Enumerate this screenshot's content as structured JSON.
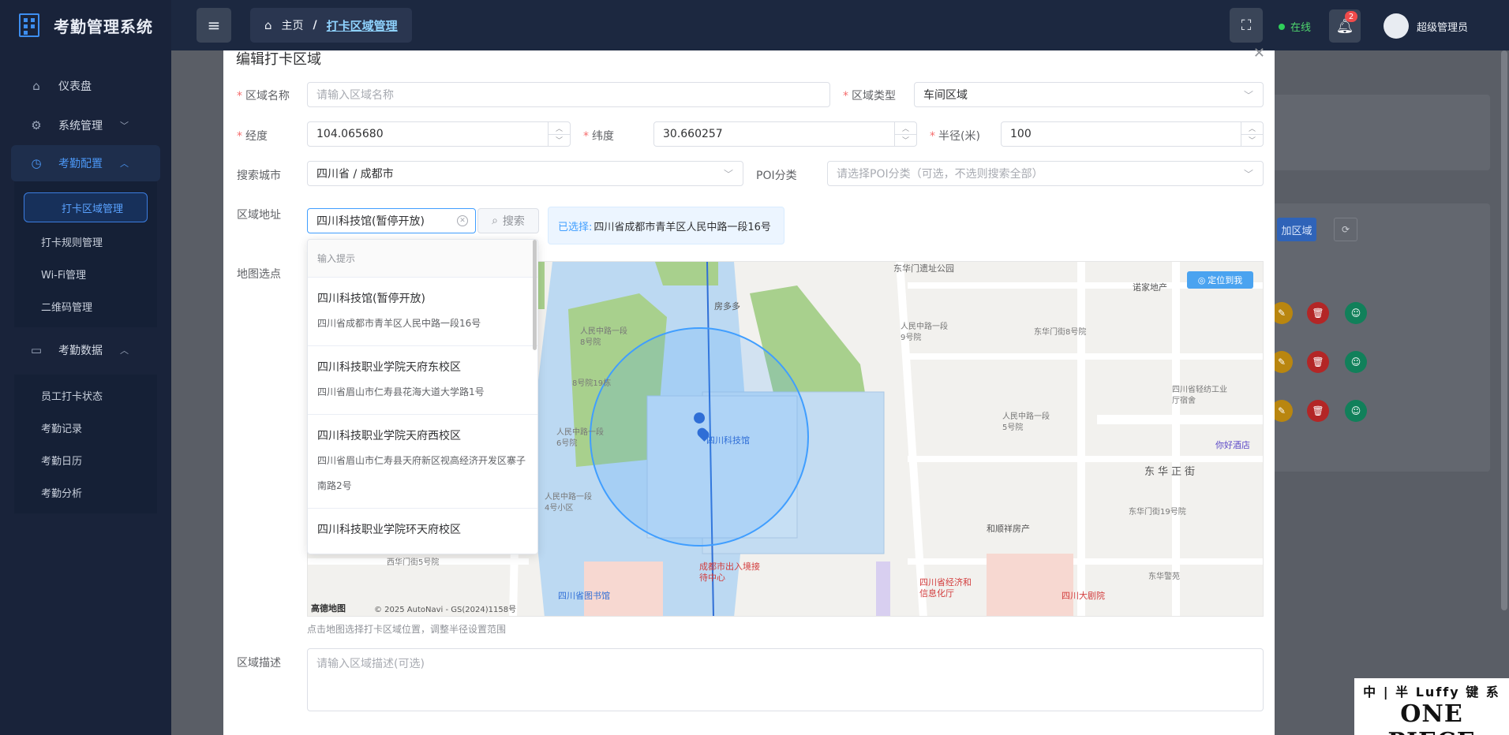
{
  "app": {
    "title": "考勤管理系统"
  },
  "sidebar": {
    "items": [
      {
        "label": "仪表盘",
        "icon": "home-icon"
      },
      {
        "label": "系统管理",
        "icon": "gear-icon"
      },
      {
        "label": "考勤配置",
        "icon": "clock-icon"
      }
    ],
    "config_sub": [
      "打卡区域管理",
      "打卡规则管理",
      "Wi-Fi管理",
      "二维码管理"
    ],
    "data_group": {
      "label": "考勤数据",
      "icon": "monitor-icon"
    },
    "data_sub": [
      "员工打卡状态",
      "考勤记录",
      "考勤日历",
      "考勤分析"
    ]
  },
  "topbar": {
    "breadcrumb": {
      "home": "主页",
      "separator": "/",
      "current": "打卡区域管理"
    },
    "status": "在线",
    "notification_count": "2",
    "user_name": "超级管理员"
  },
  "background": {
    "add_button": "加区域"
  },
  "dialog": {
    "title": "编辑打卡区域",
    "fields": {
      "name": {
        "label": "区域名称",
        "placeholder": "请输入区域名称"
      },
      "type": {
        "label": "区域类型",
        "value": "车间区域"
      },
      "longitude": {
        "label": "经度",
        "value": "104.065680"
      },
      "latitude": {
        "label": "纬度",
        "value": "30.660257"
      },
      "radius": {
        "label": "半径(米)",
        "value": "100"
      },
      "city": {
        "label": "搜索城市",
        "value": "四川省 / 成都市"
      },
      "poi": {
        "label": "POI分类",
        "placeholder": "请选择POI分类（可选，不选则搜索全部）"
      },
      "address": {
        "label": "区域地址",
        "value": "四川科技馆(暂停开放)",
        "search_button": "搜索"
      },
      "selected": {
        "prefix": "已选择:",
        "address": "四川省成都市青羊区人民中路一段16号"
      },
      "map": {
        "label": "地图选点",
        "hint": "点击地图选择打卡区域位置，调整半径设置范围",
        "locate_button": "定位到我",
        "marker_label": "四川科技馆",
        "copyright": "© 2025 AutoNavi - GS(2024)1158号",
        "brand": "高德地图"
      },
      "description": {
        "label": "区域描述",
        "placeholder": "请输入区域描述(可选)"
      }
    },
    "suggestions": {
      "header": "输入提示",
      "items": [
        {
          "name": "四川科技馆(暂停开放)",
          "address": "四川省成都市青羊区人民中路一段16号"
        },
        {
          "name": "四川科技职业学院天府东校区",
          "address": "四川省眉山市仁寿县花海大道大学路1号"
        },
        {
          "name": "四川科技职业学院天府西校区",
          "address": "四川省眉山市仁寿县天府新区视高经济开发区寨子南路2号"
        },
        {
          "name": "四川科技职业学院环天府校区",
          "address": ""
        }
      ]
    }
  },
  "map_labels": {
    "east_gate": "东华门遗址公园",
    "fangduoduo": "房多多",
    "nuojia": "诺家地产",
    "renmin1": "人民中路一段8号院",
    "renmin2": "人民中路一段9号院",
    "dongmen8": "东华门街8号院",
    "renmin6": "人民中路一段6号院",
    "renmin5": "人民中路一段5号院",
    "renmin4": "人民中路一段4号小区",
    "xihua5": "西华门街5号院",
    "dongmen19": "东华门街19号院",
    "dongzheng": "东华正街",
    "hotel": "你好酒店",
    "fangchan": "和顺祥房产",
    "chujing": "成都市出入境接待中心",
    "library": "四川省图书馆",
    "econ": "四川省经济和信息化厅",
    "theater": "四川大剧院",
    "textile": "四川省轻纺工业厅宿舍",
    "dongjing": "东华警苑",
    "b8_19": "8号院19栋"
  },
  "watermark": {
    "line1": "中 | 半 Luffy 键 系",
    "line2": "ONE PIECE"
  }
}
